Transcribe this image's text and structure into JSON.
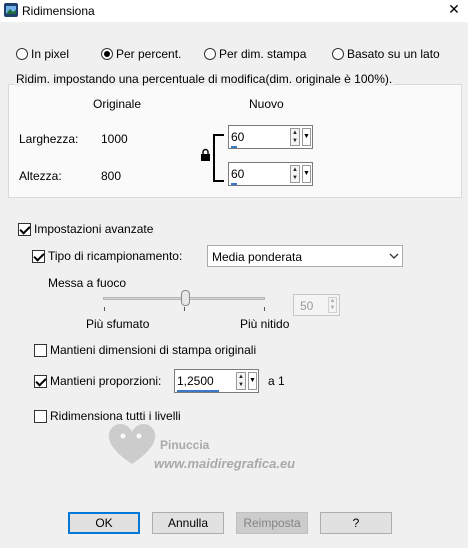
{
  "window": {
    "title": "Ridimensiona"
  },
  "mode_options": [
    {
      "label": "In pixel",
      "selected": false
    },
    {
      "label": "Per percent.",
      "selected": true
    },
    {
      "label": "Per dim. stampa",
      "selected": false
    },
    {
      "label": "Basato su un lato",
      "selected": false
    }
  ],
  "percent_group": {
    "legend": "Ridim. impostando una percentuale di modifica(dim. originale è 100%).",
    "col_original": "Originale",
    "col_new": "Nuovo",
    "width_label": "Larghezza:",
    "width_original": "1000",
    "width_new": "60",
    "height_label": "Altezza:",
    "height_original": "800",
    "height_new": "60"
  },
  "advanced": {
    "label": "Impostazioni avanzate",
    "checked": true,
    "resample_label": "Tipo di ricampionamento:",
    "resample_checked": true,
    "resample_value": "Media ponderata",
    "sharpen_label": "Messa a fuoco",
    "slider_left": "Più sfumato",
    "slider_right": "Più nitido",
    "slider_level": 0.5,
    "sharpen_value": "50",
    "keep_print": "Mantieni dimensioni di stampa originali",
    "keep_print_checked": false,
    "keep_ratio": "Mantieni proporzioni:",
    "keep_ratio_checked": true,
    "ratio_value": "1,2500",
    "ratio_suffix": "a 1",
    "resize_all": "Ridimensiona tutti i livelli",
    "resize_all_checked": false
  },
  "watermark": {
    "line1": "Pinuccia",
    "line2": "www.maidiregrafica.eu"
  },
  "buttons": {
    "ok": "OK",
    "cancel": "Annulla",
    "reset": "Reimposta",
    "help": "?"
  },
  "colors": {
    "accent": "#0078d7",
    "title_icon": "#2b6cb0"
  }
}
